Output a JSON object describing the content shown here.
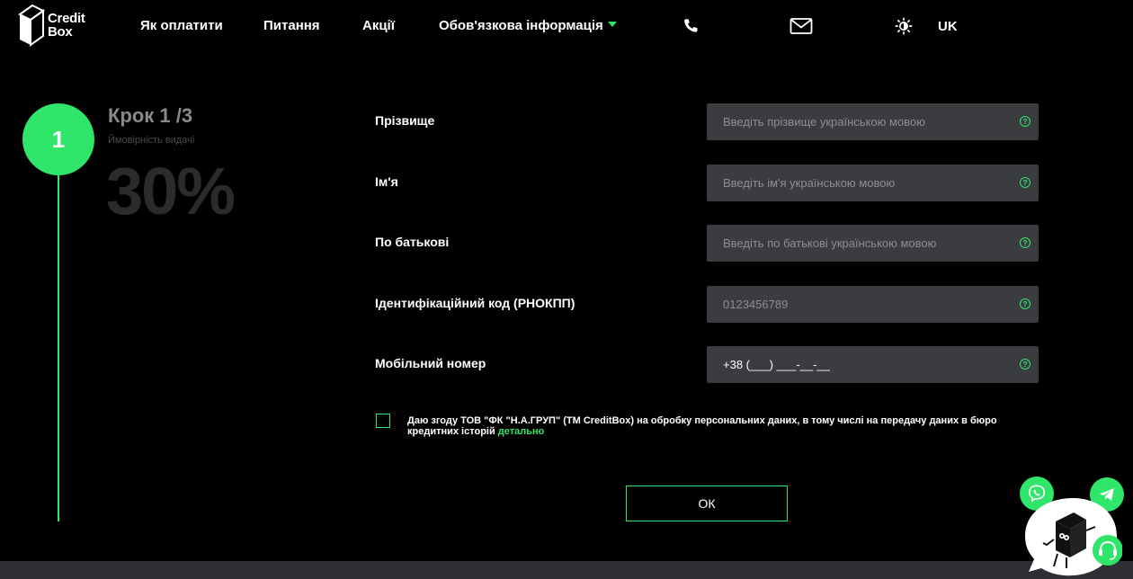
{
  "brand": {
    "line1": "Credit",
    "line2": "Box"
  },
  "nav": {
    "how_to_pay": "Як оплатити",
    "questions": "Питання",
    "promotions": "Акції",
    "mandatory_info": "Обов'язкова інформація"
  },
  "header": {
    "lang": "UK"
  },
  "step": {
    "number": "1",
    "title": "Крок 1 /3",
    "subtitle": "Ймовірність видачі",
    "percent": "30%"
  },
  "form": {
    "surname": {
      "label": "Прізвище",
      "placeholder": "Введіть прізвище українською мовою"
    },
    "name": {
      "label": "Ім'я",
      "placeholder": "Введіть ім'я українською мовою"
    },
    "patronymic": {
      "label": "По батькові",
      "placeholder": "Введіть по батькові українською мовою"
    },
    "tax_id": {
      "label": "Ідентифікаційний код (РНОКПП)",
      "placeholder": "0123456789"
    },
    "phone": {
      "label": "Мобільний номер",
      "value": "+38 (___) ___-__-__"
    },
    "help_glyph": "?",
    "consent_text": "Даю згоду ТОВ \"ФК \"Н.А.ГРУП\" (ТМ CreditBox) на обробку персональних даних, в тому числі на передачу даних в бюро кредитних історій",
    "consent_link": "детально",
    "submit": "ОК"
  },
  "colors": {
    "accent": "#2fe56a",
    "background": "#000000",
    "input_bg": "#3a3c40"
  },
  "icons": [
    "phone-icon",
    "mail-icon",
    "theme-sun-icon",
    "help-icon",
    "viber-icon",
    "telegram-icon",
    "support-headset-icon"
  ]
}
